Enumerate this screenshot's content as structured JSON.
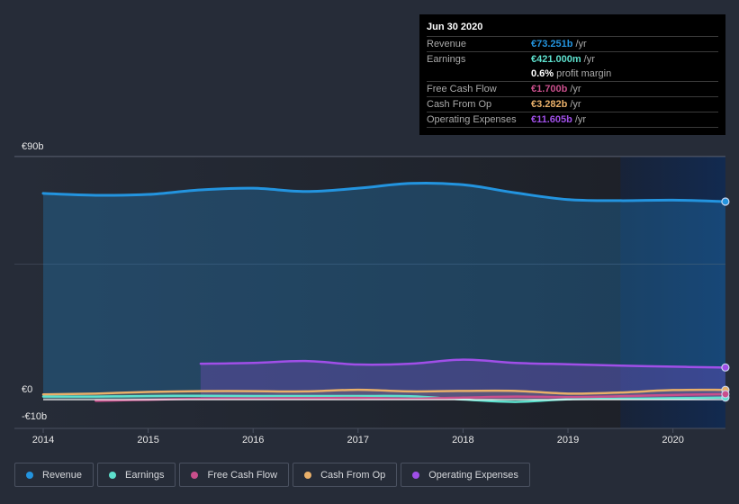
{
  "tooltip": {
    "date": "Jun 30 2020",
    "rows": [
      {
        "label": "Revenue",
        "value": "€73.251b",
        "unit": "/yr",
        "color": "#2394df"
      },
      {
        "label": "Earnings",
        "value": "€421.000m",
        "unit": "/yr",
        "color": "#5de0cd"
      },
      {
        "label": "",
        "value": "0.6%",
        "unit": "profit margin",
        "color": "#ffffff"
      },
      {
        "label": "Free Cash Flow",
        "value": "€1.700b",
        "unit": "/yr",
        "color": "#c94f8c"
      },
      {
        "label": "Cash From Op",
        "value": "€3.282b",
        "unit": "/yr",
        "color": "#e9b06a"
      },
      {
        "label": "Operating Expenses",
        "value": "€11.605b",
        "unit": "/yr",
        "color": "#a04fe8"
      }
    ]
  },
  "legend": [
    {
      "label": "Revenue",
      "color": "#2394df"
    },
    {
      "label": "Earnings",
      "color": "#5de0cd"
    },
    {
      "label": "Free Cash Flow",
      "color": "#c94f8c"
    },
    {
      "label": "Cash From Op",
      "color": "#e9b06a"
    },
    {
      "label": "Operating Expenses",
      "color": "#a04fe8"
    }
  ],
  "chart_data": {
    "type": "area",
    "title": "",
    "xlabel": "",
    "ylabel": "",
    "y_tick_labels": [
      "€90b",
      "€0",
      "-€10b"
    ],
    "y_ticks": [
      90,
      0,
      -10
    ],
    "ylim": [
      -10,
      90
    ],
    "xlim": [
      2014.0,
      2020.5
    ],
    "x_tick_labels": [
      "2014",
      "2015",
      "2016",
      "2017",
      "2018",
      "2019",
      "2020"
    ],
    "x_ticks": [
      2014,
      2015,
      2016,
      2017,
      2018,
      2019,
      2020
    ],
    "highlight_range": [
      2019.5,
      2020.5
    ],
    "grid": true,
    "legend_position": "bottom",
    "series": [
      {
        "name": "Revenue",
        "color": "#2394df",
        "x": [
          2014.0,
          2014.5,
          2015.0,
          2015.5,
          2016.0,
          2016.5,
          2017.0,
          2017.5,
          2018.0,
          2018.5,
          2019.0,
          2019.5,
          2020.0,
          2020.5
        ],
        "values": [
          76.3,
          75.6,
          75.9,
          77.6,
          78.2,
          77.0,
          78.2,
          80.0,
          79.5,
          76.5,
          74.0,
          73.6,
          73.8,
          73.25
        ]
      },
      {
        "name": "Operating Expenses",
        "color": "#a04fe8",
        "x": [
          2015.5,
          2016.0,
          2016.5,
          2017.0,
          2017.5,
          2018.0,
          2018.5,
          2019.0,
          2019.5,
          2020.0,
          2020.5
        ],
        "values": [
          13.0,
          13.3,
          14.0,
          12.7,
          13.0,
          14.5,
          13.3,
          12.8,
          12.3,
          11.9,
          11.6
        ]
      },
      {
        "name": "Cash From Op",
        "color": "#e9b06a",
        "x": [
          2014.0,
          2014.5,
          2015.0,
          2015.5,
          2016.0,
          2016.5,
          2017.0,
          2017.5,
          2018.0,
          2018.5,
          2019.0,
          2019.5,
          2020.0,
          2020.5
        ],
        "values": [
          1.6,
          1.9,
          2.5,
          2.8,
          2.8,
          2.7,
          3.3,
          2.7,
          2.9,
          2.9,
          1.9,
          2.3,
          3.2,
          3.28
        ]
      },
      {
        "name": "Earnings",
        "color": "#5de0cd",
        "x": [
          2014.0,
          2014.5,
          2015.0,
          2015.5,
          2016.0,
          2016.5,
          2017.0,
          2017.5,
          2018.0,
          2018.5,
          2019.0,
          2019.5,
          2020.0,
          2020.5
        ],
        "values": [
          0.8,
          0.8,
          1.0,
          1.1,
          1.0,
          1.0,
          1.0,
          0.9,
          -0.3,
          -1.2,
          -0.2,
          0.0,
          0.2,
          0.42
        ]
      },
      {
        "name": "Free Cash Flow",
        "color": "#c94f8c",
        "x": [
          2014.5,
          2015.0,
          2015.5,
          2016.0,
          2016.5,
          2017.0,
          2017.5,
          2018.0,
          2018.5,
          2019.0,
          2019.5,
          2020.0,
          2020.5
        ],
        "values": [
          -0.8,
          -0.4,
          0.0,
          0.1,
          0.2,
          0.3,
          0.0,
          0.4,
          0.8,
          0.6,
          0.9,
          1.4,
          1.7
        ]
      }
    ]
  }
}
